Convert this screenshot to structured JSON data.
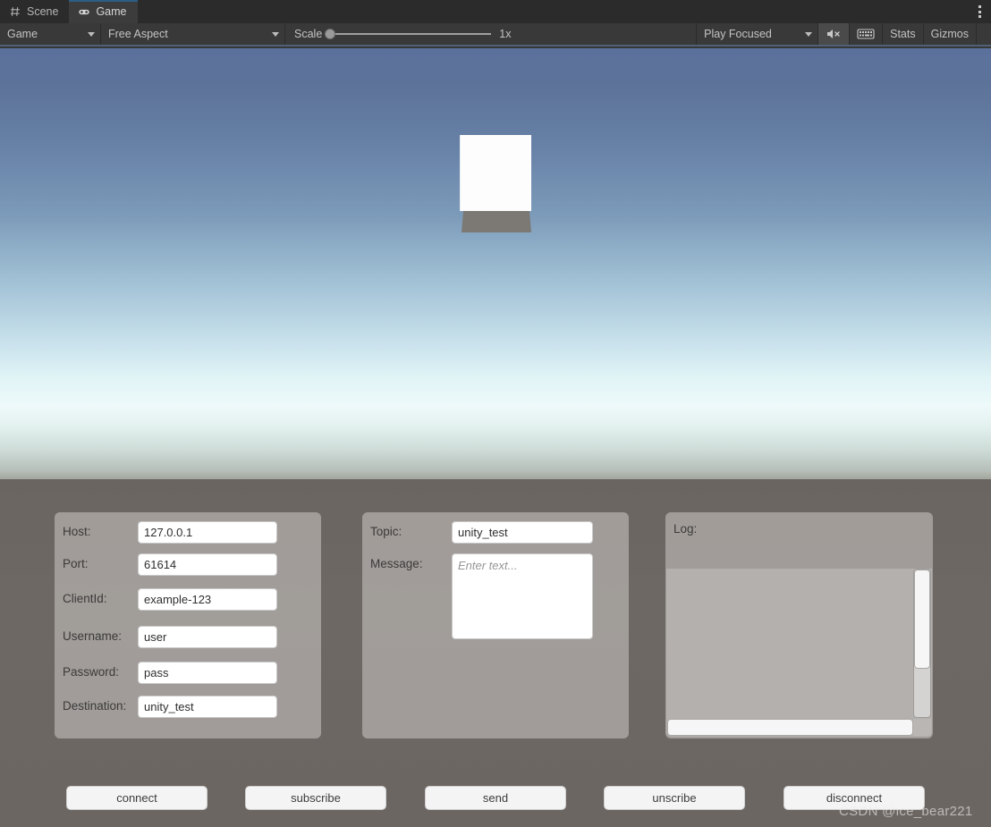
{
  "tabs": [
    {
      "label": "Scene",
      "icon": "grid-icon",
      "active": false
    },
    {
      "label": "Game",
      "icon": "gamepad-icon",
      "active": true
    }
  ],
  "window_menu": {
    "icon": "kebab-menu-icon"
  },
  "toolbar": {
    "target_display": "Game",
    "aspect": "Free Aspect",
    "scale_label": "Scale",
    "scale_value": "1x",
    "play_mode": "Play Focused",
    "mute_audio_icon": "mute-audio-icon",
    "stats_toggle_icon": "stats-grid-icon",
    "stats_label": "Stats",
    "gizmos_label": "Gizmos"
  },
  "scene": {
    "sky_top_color": "#5b719c",
    "sky_horizon_color": "#eefafa",
    "ground_color": "#6e6864",
    "cube_color": "#fdfdfd",
    "cube_shadow_color": "#7c7974"
  },
  "connection_panel": {
    "fields": [
      {
        "label": "Host:",
        "value": "127.0.0.1"
      },
      {
        "label": "Port:",
        "value": "61614"
      },
      {
        "label": "ClientId:",
        "value": "example-123"
      },
      {
        "label": "Username:",
        "value": "user"
      },
      {
        "label": "Password:",
        "value": "pass"
      },
      {
        "label": "Destination:",
        "value": "unity_test"
      }
    ]
  },
  "message_panel": {
    "topic_label": "Topic:",
    "topic_value": "unity_test",
    "message_label": "Message:",
    "message_value": "",
    "message_placeholder": "Enter text..."
  },
  "log_panel": {
    "label": "Log:",
    "content": ""
  },
  "actions": [
    {
      "id": "connect",
      "label": "connect"
    },
    {
      "id": "subscribe",
      "label": "subscribe"
    },
    {
      "id": "send",
      "label": "send"
    },
    {
      "id": "unscribe",
      "label": "unscribe"
    },
    {
      "id": "disconnect",
      "label": "disconnect"
    }
  ],
  "watermark": "CSDN @ice_bear221"
}
